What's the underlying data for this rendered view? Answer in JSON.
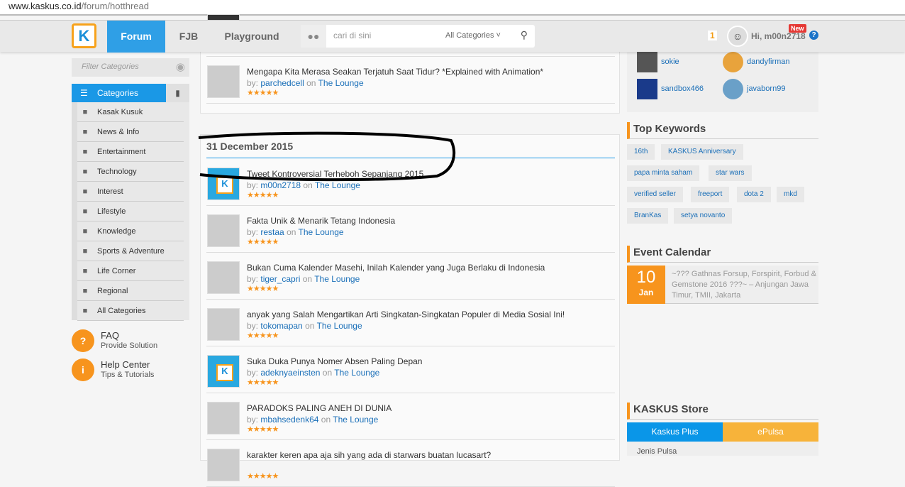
{
  "browser": {
    "url_host": "www.kaskus.co.id",
    "url_path": "/forum/hotthread"
  },
  "nav": {
    "logo": "K",
    "tabs": [
      "Forum",
      "FJB",
      "Playground"
    ],
    "active": "Forum",
    "search_placeholder": "cari di sini",
    "search_category": "All Categories",
    "notif_count": "1",
    "greeting": "Hi, m00n2718",
    "new_badge": "New",
    "help": "?"
  },
  "colors": {
    "brand_blue": "#1a98e6",
    "accent_orange": "#f7941d",
    "link": "#1a6fb8"
  },
  "sidebar": {
    "filter_placeholder": "Filter Categories",
    "categories_label": "Categories",
    "items": [
      {
        "label": "Kasak Kusuk",
        "icon": "chat-icon"
      },
      {
        "label": "News & Info",
        "icon": "briefcase-icon"
      },
      {
        "label": "Entertainment",
        "icon": "film-icon"
      },
      {
        "label": "Technology",
        "icon": "rocket-icon"
      },
      {
        "label": "Interest",
        "icon": "palette-icon"
      },
      {
        "label": "Lifestyle",
        "icon": "bottle-icon"
      },
      {
        "label": "Knowledge",
        "icon": "bulb-icon"
      },
      {
        "label": "Sports & Adventure",
        "icon": "ball-icon"
      },
      {
        "label": "Life Corner",
        "icon": "apple-icon"
      },
      {
        "label": "Regional",
        "icon": "pin-icon"
      },
      {
        "label": "All Categories",
        "icon": "tree-icon"
      }
    ],
    "help": [
      {
        "title": "FAQ",
        "sub": "Provide Solution",
        "icon": "?"
      },
      {
        "title": "Help Center",
        "sub": "Tips & Tutorials",
        "icon": "i"
      }
    ]
  },
  "main": {
    "top_threads": [
      {
        "title": "Mengapa Kita Merasa Seakan Terjatuh Saat Tidur? *Explained with Animation*",
        "author": "parchedcell",
        "forum": "The Lounge",
        "rating": 5
      }
    ],
    "section_date": "31 December 2015",
    "threads": [
      {
        "title": "Tweet Kontroversial Terheboh Sepanjang 2015",
        "author": "m00n2718",
        "forum": "The Lounge",
        "rating": 5,
        "thumb": "kaskus"
      },
      {
        "title": "Fakta Unik & Menarik Tetang Indonesia",
        "author": "restaa",
        "forum": "The Lounge",
        "rating": 5,
        "thumb": "img"
      },
      {
        "title": "Bukan Cuma Kalender Masehi, Inilah Kalender yang Juga Berlaku di Indonesia",
        "author": "tiger_capri",
        "forum": "The Lounge",
        "rating": 5,
        "thumb": "img"
      },
      {
        "title": "anyak yang Salah Mengartikan Arti Singkatan-Singkatan Populer di Media Sosial Ini!",
        "author": "tokomapan",
        "forum": "The Lounge",
        "rating": 5,
        "thumb": "img"
      },
      {
        "title": "Suka Duka Punya Nomer Absen Paling Depan",
        "author": "adeknyaeinsten",
        "forum": "The Lounge",
        "rating": 5,
        "thumb": "kaskus"
      },
      {
        "title": "PARADOKS PALING ANEH DI DUNIA",
        "author": "mbahsedenk64",
        "forum": "The Lounge",
        "rating": 5,
        "thumb": "img"
      },
      {
        "title": "karakter keren apa aja sih yang ada di starwars buatan lucasart?",
        "author": "",
        "forum": "",
        "rating": 5,
        "thumb": "img"
      }
    ],
    "by_label": "by:",
    "on_label": "on"
  },
  "right": {
    "users": [
      "sokie",
      "dandyfirman",
      "sandbox466",
      "javaborn99"
    ],
    "keywords_title": "Top Keywords",
    "keywords": [
      "16th",
      "KASKUS Anniversary",
      "papa minta saham",
      "star wars",
      "verified seller",
      "freeport",
      "dota 2",
      "mkd",
      "BranKas",
      "setya novanto"
    ],
    "event_title": "Event Calendar",
    "event": {
      "day": "10",
      "month": "Jan",
      "text": "~??? Gathnas Forsup, Forspirit, Forbud & Gemstone 2016 ???~ – Anjungan Jawa Timur, TMII, Jakarta"
    },
    "store_title": "KASKUS Store",
    "store_tabs": [
      "Kaskus Plus",
      "ePulsa"
    ],
    "store_field": "Jenis Pulsa"
  }
}
